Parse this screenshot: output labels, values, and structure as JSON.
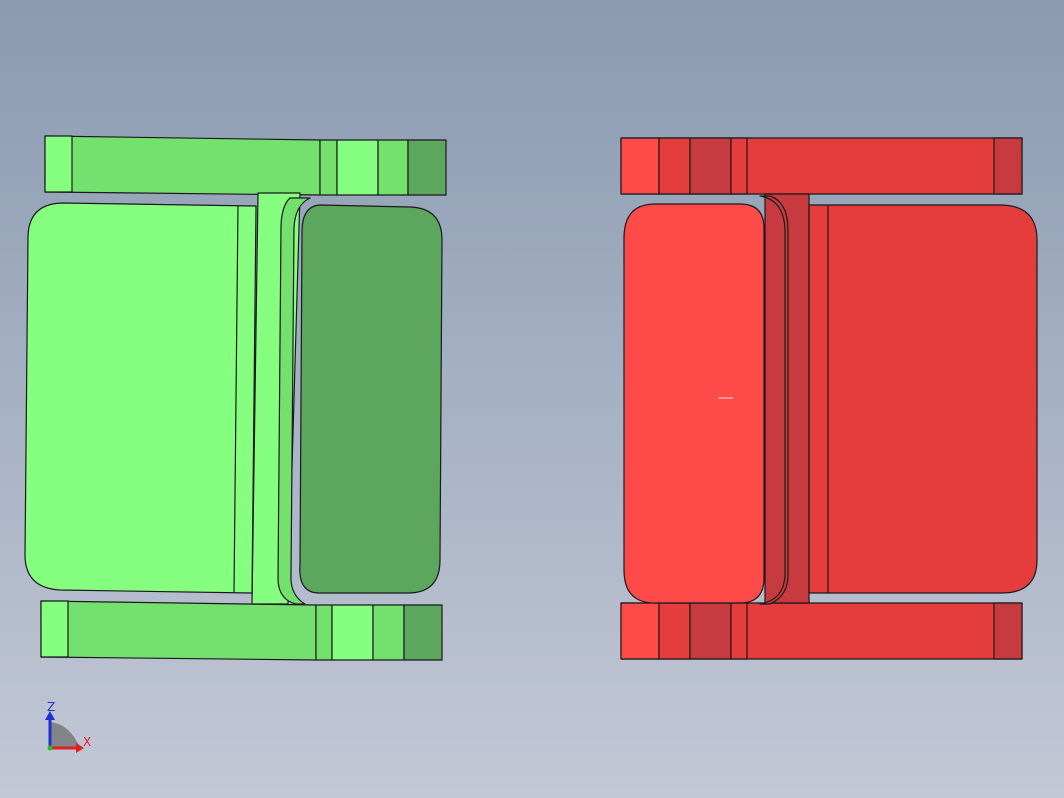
{
  "viewport": {
    "background_top": "#8a9ab0",
    "background_bottom": "#c3c8d6"
  },
  "parts": [
    {
      "name": "green-part",
      "colors": {
        "light": "#86ff80",
        "mid": "#74e06e",
        "dark": "#5ca65e",
        "edge": "#1a1a1a"
      }
    },
    {
      "name": "red-part",
      "colors": {
        "light": "#ff4a4a",
        "mid": "#e53d3d",
        "dark": "#c73b40",
        "edge": "#1a1a1a"
      }
    }
  ],
  "axis_triad": {
    "z_label": "Z",
    "x_label": "X",
    "z_color": "#1f2fd0",
    "x_color": "#e02020",
    "origin_color": "#20c020"
  }
}
